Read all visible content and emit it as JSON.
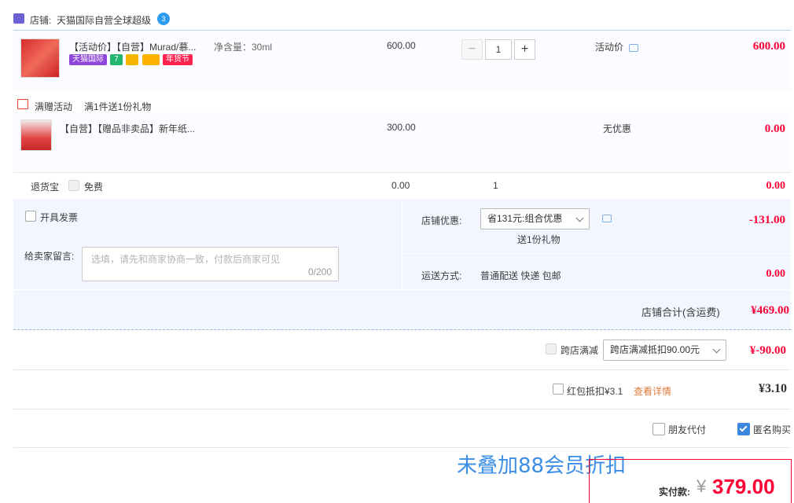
{
  "shop": {
    "label": "店铺:",
    "name": "天猫国际自营全球超级",
    "badge_text": "3"
  },
  "item1": {
    "title": "【活动价】【自营】Murad/慕...",
    "spec": "净含量：30ml",
    "price": "600.00",
    "quantity": "1",
    "promo_label": "活动价",
    "subtotal": "600.00",
    "tags": [
      "天猫国际",
      "7",
      "",
      "",
      "年货节"
    ]
  },
  "gift_promo": {
    "label": "满赠活动",
    "desc": "满1件送1份礼物"
  },
  "item2": {
    "title": "【自营】【赠品非卖品】新年纸...",
    "price": "300.00",
    "promo_label": "无优惠",
    "subtotal": "0.00"
  },
  "return_insurance": {
    "label": "退货宝",
    "free_label": "免费",
    "price": "0.00",
    "qty": "1",
    "subtotal": "0.00"
  },
  "invoice": {
    "label": "开具发票"
  },
  "message": {
    "label": "给卖家留言:",
    "placeholder": "选填，请先和商家协商一致，付款后商家可见",
    "counter": "0/200"
  },
  "shop_discount": {
    "label": "店铺优惠:",
    "selected": "省131元:组合优惠",
    "note": "送1份礼物",
    "amount": "-131.00"
  },
  "shipping": {
    "label": "运送方式:",
    "method": "普通配送 快递 包邮",
    "amount": "0.00"
  },
  "shop_total": {
    "label": "店铺合计(含运费)",
    "amount": "¥469.00"
  },
  "cross_store": {
    "label": "跨店满减",
    "selected": "跨店满减抵扣90.00元",
    "amount": "¥-90.00"
  },
  "red_packet": {
    "label": "红包抵扣¥3.1",
    "link": "查看详情",
    "amount": "¥3.10"
  },
  "options": {
    "friend_pay": "朋友代付",
    "anonymous": "匿名购买"
  },
  "overlay_note": "未叠加88会员折扣",
  "payment": {
    "label": "实付款:",
    "currency": "¥",
    "amount": "379.00"
  },
  "colors": {
    "price_red": "#ff0036",
    "accent_blue": "#3c86dd",
    "panel_bg": "#f2f7ff"
  }
}
